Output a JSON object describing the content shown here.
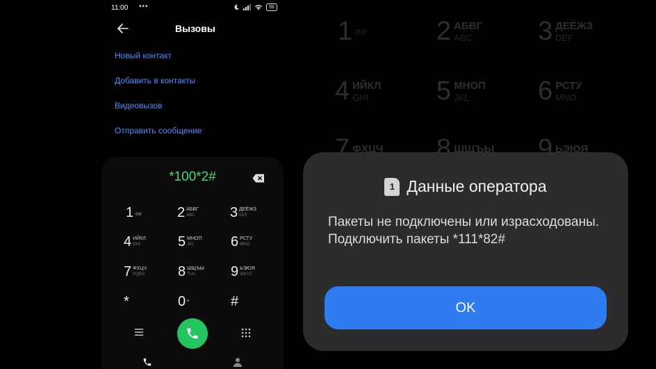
{
  "status_bar": {
    "time": "11:00",
    "more": "•••",
    "battery": "98"
  },
  "header": {
    "title": "Вызовы"
  },
  "menu": [
    "Новый контакт",
    "Добавить в контакты",
    "Видеовызов",
    "Отправить сообщение"
  ],
  "dialer": {
    "number": "*100*2#"
  },
  "keys": [
    {
      "digit": "1",
      "l1": "",
      "l2": ""
    },
    {
      "digit": "2",
      "l1": "АБВГ",
      "l2": "ABC"
    },
    {
      "digit": "3",
      "l1": "ДЕЁЖЗ",
      "l2": "DEF"
    },
    {
      "digit": "4",
      "l1": "ИЙКЛ",
      "l2": "GHI"
    },
    {
      "digit": "5",
      "l1": "МНОП",
      "l2": "JKL"
    },
    {
      "digit": "6",
      "l1": "РСТУ",
      "l2": "MNO"
    },
    {
      "digit": "7",
      "l1": "ФХЦЧ",
      "l2": "PQRS"
    },
    {
      "digit": "8",
      "l1": "ШЩЪЫ",
      "l2": "TUV"
    },
    {
      "digit": "9",
      "l1": "ЬЭЮЯ",
      "l2": "WXYZ"
    },
    {
      "digit": "*",
      "l1": "",
      "l2": ""
    },
    {
      "digit": "0",
      "l1": "",
      "l2": ""
    },
    {
      "digit": "#",
      "l1": "",
      "l2": ""
    }
  ],
  "voicemail_glyph": "σσ",
  "plus_sign": "+",
  "background_keys": [
    {
      "digit": "1",
      "l1": "",
      "l2": ""
    },
    {
      "digit": "2",
      "l1": "АБВГ",
      "l2": "ABC"
    },
    {
      "digit": "3",
      "l1": "ДЕЁЖЗ",
      "l2": "DEF"
    },
    {
      "digit": "4",
      "l1": "ИЙКЛ",
      "l2": "GHI"
    },
    {
      "digit": "5",
      "l1": "МНОП",
      "l2": "JKL"
    },
    {
      "digit": "6",
      "l1": "РСТУ",
      "l2": "MNO"
    },
    {
      "digit": "7",
      "l1": "ФХЦЧ",
      "l2": ""
    },
    {
      "digit": "8",
      "l1": "ШЩЪЫ",
      "l2": ""
    },
    {
      "digit": "9",
      "l1": "ЬЭЮЯ",
      "l2": ""
    }
  ],
  "dialog": {
    "sim_slot": "1",
    "title": "Данные оператора",
    "message": "Пакеты не подключены или израсходованы. Подключить пакеты *111*82#",
    "ok_label": "OK"
  },
  "colors": {
    "accent": "#2f7bf0",
    "link": "#4f8cff",
    "number": "#46d97c",
    "call": "#22c55e",
    "dialog_bg": "#2c2c2e"
  }
}
